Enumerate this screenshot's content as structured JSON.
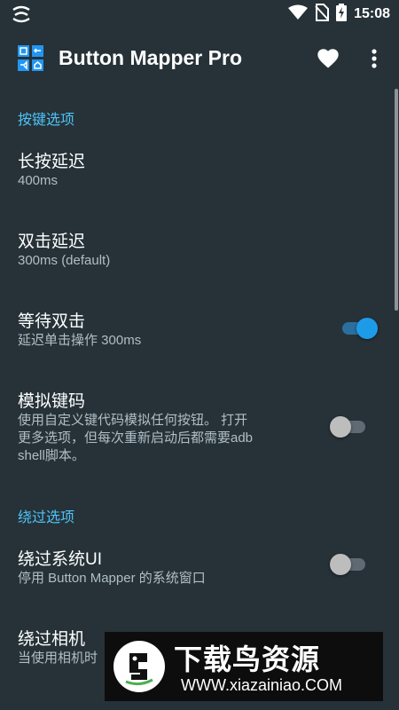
{
  "status_bar": {
    "time": "15:08",
    "icons": [
      "notification-app-icon",
      "wifi-icon",
      "no-sim-icon",
      "battery-charging-icon"
    ]
  },
  "app_bar": {
    "title": "Button Mapper Pro",
    "actions": [
      "heart-icon",
      "more-vert-icon"
    ]
  },
  "sections": [
    {
      "header": "按键选项",
      "items": [
        {
          "title": "长按延迟",
          "summary": "400ms"
        },
        {
          "title": "双击延迟",
          "summary": "300ms (default)"
        },
        {
          "title": "等待双击",
          "summary": "延迟单击操作 300ms",
          "toggle": true
        },
        {
          "title": "模拟键码",
          "summary_lines": [
            "使用自定义键代码模拟任何按钮。 打开",
            "更多选项，但每次重新启动后都需要adb",
            "shell脚本。"
          ],
          "toggle": false
        }
      ]
    },
    {
      "header": "绕过选项",
      "items": [
        {
          "title": "绕过系统UI",
          "summary": "停用 Button Mapper 的系统窗口",
          "toggle": false
        },
        {
          "title": "绕过相机",
          "summary": "当使用相机时"
        }
      ]
    }
  ],
  "watermark": {
    "title": "下载鸟资源",
    "url": "WWW.xiazainiao.COM"
  },
  "colors": {
    "background": "#263238",
    "accent": "#4fc3f7",
    "toggle_on": "#1e9be8",
    "toggle_off": "#bdbdbd"
  }
}
